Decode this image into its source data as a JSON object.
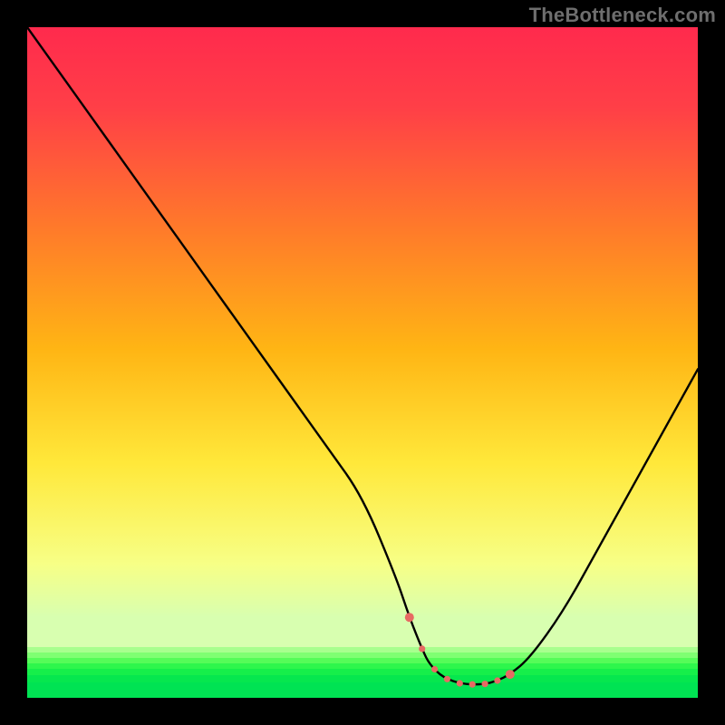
{
  "watermark": "TheBottleneck.com",
  "colors": {
    "red_top": "#ff2a4d",
    "orange": "#ff8a1f",
    "yellow": "#ffe83a",
    "yellow_pale": "#f7ff86",
    "green_light": "#9cff7e",
    "green_mid": "#3eff57",
    "green_deep": "#00e851",
    "curve": "#000000",
    "dot": "#e76a63",
    "background": "#000000"
  },
  "chart_data": {
    "type": "line",
    "title": "",
    "xlabel": "",
    "ylabel": "",
    "xlim": [
      0,
      100
    ],
    "ylim": [
      0,
      100
    ],
    "x": [
      0,
      5,
      10,
      15,
      20,
      25,
      30,
      35,
      40,
      45,
      50,
      55,
      57,
      59,
      60,
      62,
      65,
      68,
      70,
      72,
      75,
      80,
      85,
      90,
      95,
      100
    ],
    "values": [
      100,
      93,
      86,
      79,
      72,
      65,
      58,
      51,
      44,
      37,
      30,
      18,
      12,
      7,
      5,
      3,
      2,
      2,
      2.5,
      3.5,
      6,
      13,
      22,
      31,
      40,
      49
    ],
    "highlight_region": {
      "x_start": 57,
      "x_end": 72,
      "y": 4
    },
    "annotations": []
  }
}
